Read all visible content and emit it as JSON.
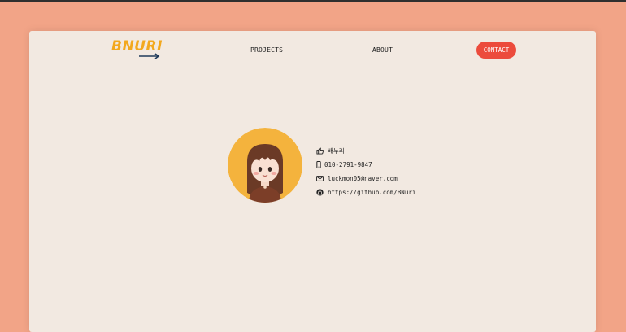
{
  "header": {
    "logo": "BNURI",
    "nav": {
      "projects": "PROJECTS",
      "about": "ABOUT",
      "contact": "CONTACT"
    }
  },
  "profile": {
    "name": "배누리",
    "phone": "010-2791-9847",
    "email": "luckmon05@naver.com",
    "github": "https://github.com/BNuri"
  },
  "colors": {
    "background": "#F2A487",
    "card": "#F2E9E1",
    "brand": "#F3A81E",
    "contact_button": "#EC4B3C",
    "avatar_circle": "#F4B33D"
  },
  "icons": [
    "arrow-right-icon",
    "hand-pointer-icon",
    "phone-icon",
    "mail-icon",
    "github-icon"
  ]
}
